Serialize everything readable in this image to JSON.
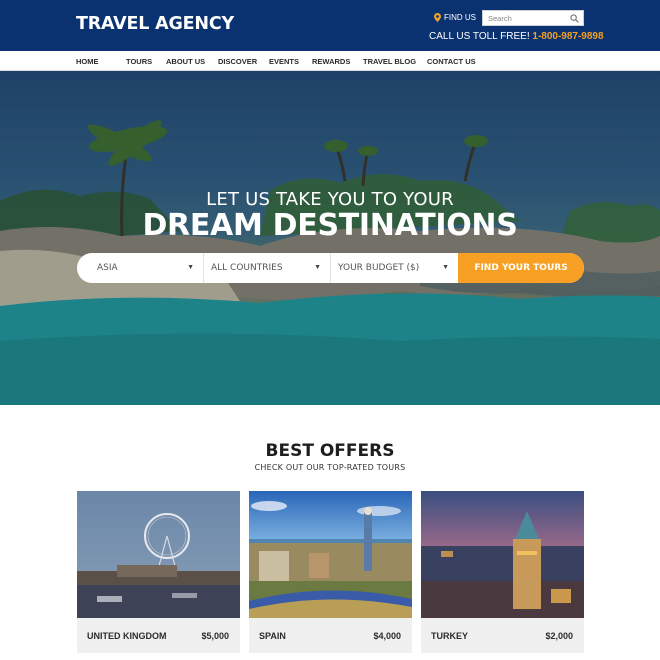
{
  "header": {
    "logo": "TRAVEL AGENCY",
    "find_us_label": "FIND US",
    "search_placeholder": "Search",
    "tollfree_label": "CALL US TOLL FREE!",
    "phone": "1-800-987-9898"
  },
  "nav": {
    "items": [
      "HOME",
      "TOURS",
      "ABOUT US",
      "DISCOVER",
      "EVENTS",
      "REWARDS",
      "TRAVEL BLOG",
      "CONTACT US"
    ]
  },
  "hero": {
    "subtitle": "LET US TAKE YOU TO YOUR",
    "title": "DREAM DESTINATIONS",
    "search_form": {
      "region": "ASIA",
      "country": "ALL COUNTRIES",
      "budget": "YOUR BUDGET ($)",
      "button": "FIND YOUR TOURS"
    }
  },
  "offers": {
    "title": "BEST OFFERS",
    "subtitle": "CHECK OUT OUR TOP-RATED TOURS",
    "cards": [
      {
        "name": "UNITED KINGDOM",
        "price": "$5,000"
      },
      {
        "name": "SPAIN",
        "price": "$4,000"
      },
      {
        "name": "TURKEY",
        "price": "$2,000"
      }
    ]
  },
  "colors": {
    "brand_navy": "#0a3270",
    "accent_orange": "#f8a024"
  }
}
